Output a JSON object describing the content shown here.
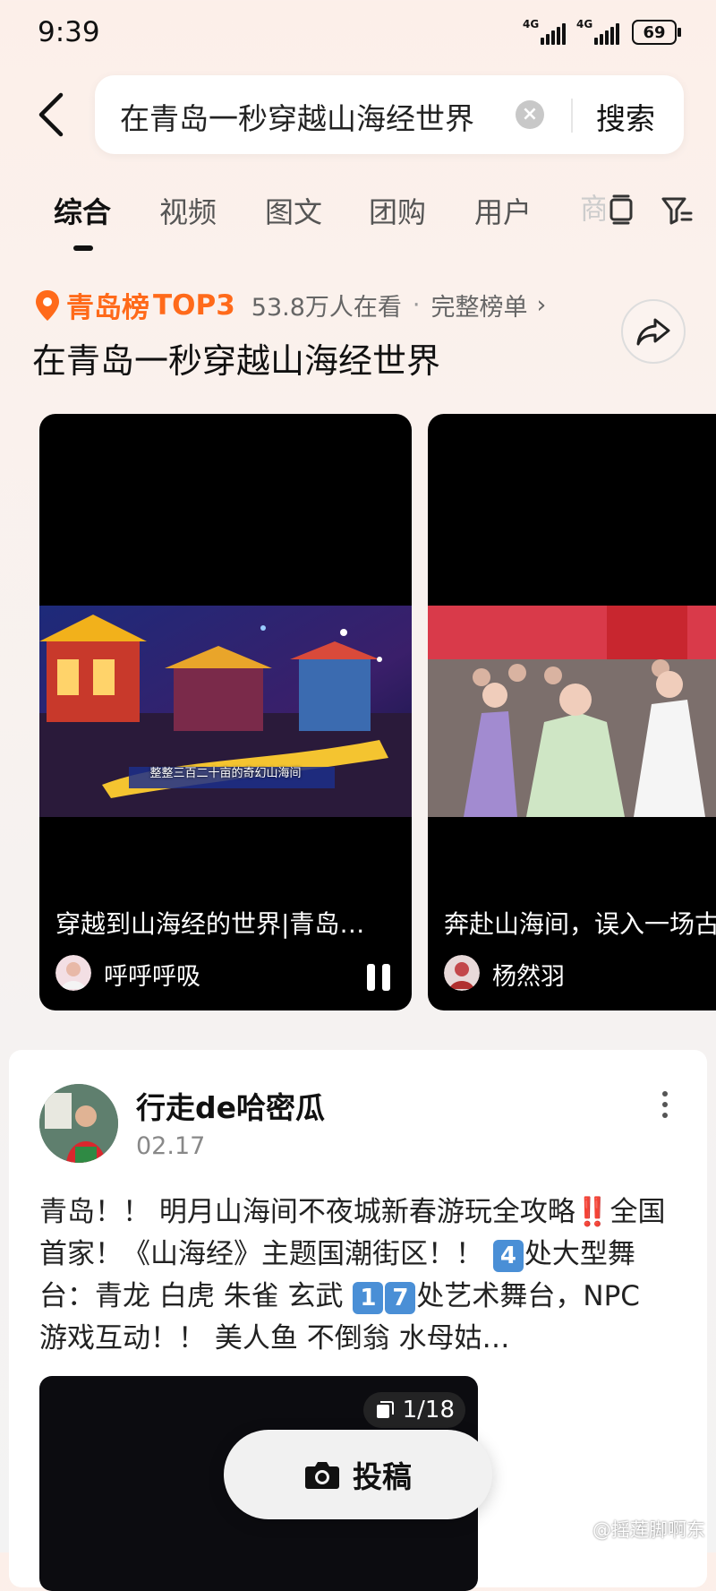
{
  "status_bar": {
    "time": "9:39",
    "network_1": "4G",
    "network_2": "4G",
    "battery": "69"
  },
  "search": {
    "query": "在青岛一秒穿越山海经世界",
    "button_label": "搜索"
  },
  "tabs": [
    {
      "label": "综合",
      "active": true
    },
    {
      "label": "视频"
    },
    {
      "label": "图文"
    },
    {
      "label": "团购"
    },
    {
      "label": "用户"
    }
  ],
  "tab_icons": [
    "window-icon",
    "filter-icon"
  ],
  "ranking": {
    "name": "青岛榜",
    "badge": "TOP3",
    "views": "53.8万人在看",
    "separator": "·",
    "full_list": "完整榜单",
    "chevron": "›",
    "topic_title": "在青岛一秒穿越山海经世界"
  },
  "videos": [
    {
      "caption": "穿越到山海经的世界|青岛…",
      "author": "呼呼呼吸",
      "subtitle": "整整三百二十亩的奇幻山海间",
      "state": "playing"
    },
    {
      "caption": "奔赴山海间，误入一场古",
      "author": "杨然羽"
    }
  ],
  "post": {
    "author": "行走de哈密瓜",
    "date": "02.17",
    "text_parts": {
      "p1": "青岛！！ 明月山海间不夜城新春游玩全攻略‼️全国首家！《山海经》主题国潮街区！！ ",
      "n1": "4",
      "p2": "处大型舞台：青龙 白虎 朱雀 玄武 ",
      "n2": "1",
      "n3": "7",
      "p3": "处艺术舞台，NPC游戏互动！！ 美人鱼 不倒翁 水母姑…"
    },
    "image_count": "1/18"
  },
  "fab": {
    "label": "投稿"
  },
  "watermark": "@摇莲脚啊东",
  "colors": {
    "accent": "#ff6a1a",
    "number_box": "#4a8fd6"
  }
}
